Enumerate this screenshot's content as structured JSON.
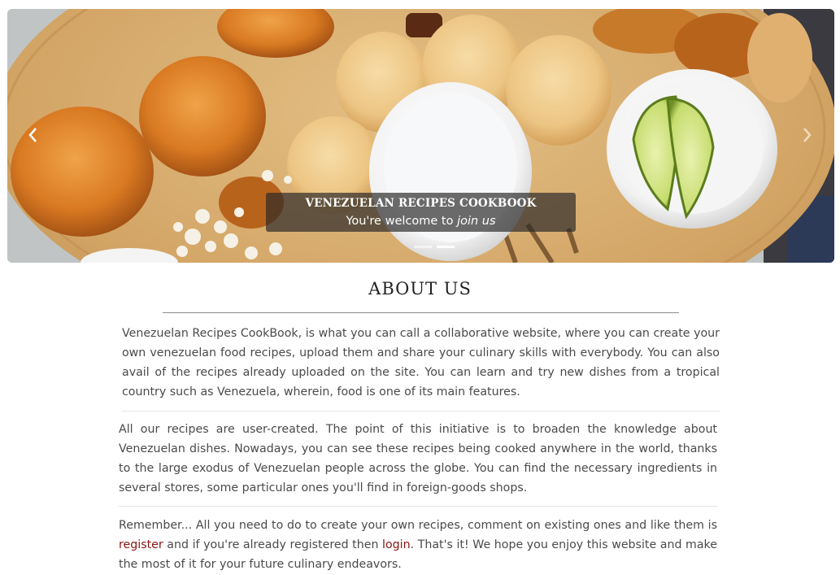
{
  "carousel": {
    "caption_title": "VENEZUELAN RECIPES COOKBOOK",
    "caption_sub_prefix": "You're welcome to ",
    "caption_sub_emphasis": "join us",
    "slide_count": 3,
    "active_slide": 2,
    "prev_icon": "chevron-left-icon",
    "next_icon": "chevron-right-icon"
  },
  "about": {
    "title": "ABOUT US",
    "paragraph1": "Venezuelan Recipes CookBook, is what you can call a collaborative website, where you can create your own venezuelan food recipes, upload them and share your culinary skills with everybody. You can also avail of the recipes already uploaded on the site. You can learn and try new dishes from a tropical country such as Venezuela, wherein, food is one of its main features.",
    "paragraph2": "All our recipes are user-created. The point of this initiative is to broaden the knowledge about Venezuelan dishes. Nowadays, you can see these recipes being cooked anywhere in the world, thanks to the large exodus of Venezuelan people across the globe. You can find the necessary ingredients in several stores, some particular ones you'll find in foreign-goods shops.",
    "paragraph3_part1": "Remember... All you need to do to create your own recipes, comment on existing ones and like them is ",
    "register_link": "register",
    "paragraph3_part2": " and if you're already registered then ",
    "login_link": "login",
    "paragraph3_part3": ". That's it! We hope you enjoy this website and make the most of it for your future culinary endeavors."
  },
  "colors": {
    "link": "#8b1414",
    "caption_bg": "rgba(40,38,40,0.68)",
    "board_wood": "#d9b27a",
    "arepa_golden": "#f0cc8c"
  }
}
